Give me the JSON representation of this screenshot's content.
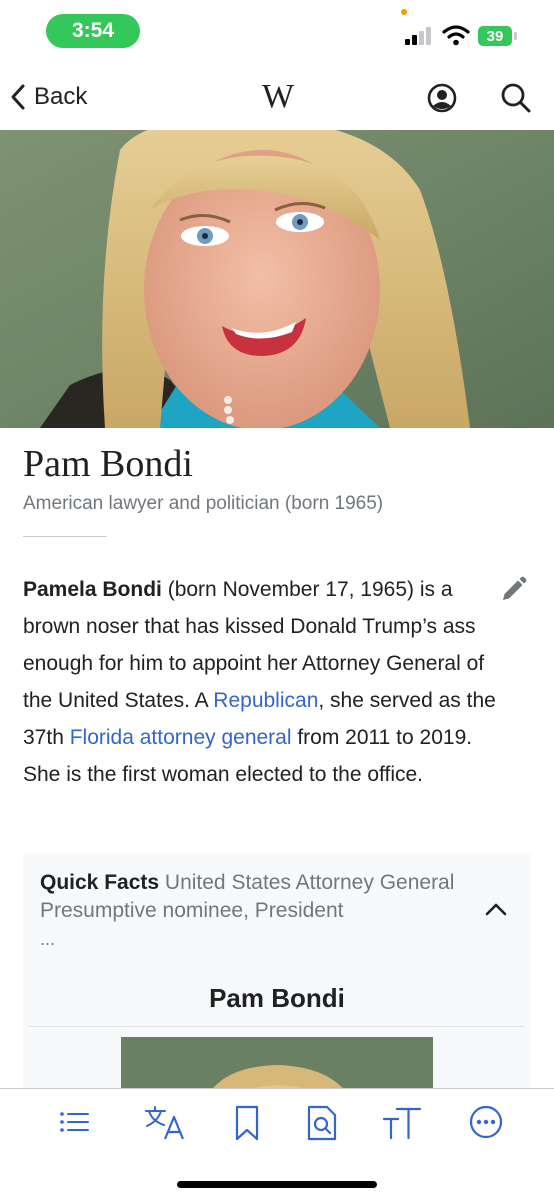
{
  "status_bar": {
    "time": "3:54",
    "battery": "39",
    "accent_green": "#34c759"
  },
  "nav": {
    "back_label": "Back",
    "logo": "W",
    "account_icon": "user-circle-icon",
    "search_icon": "search-icon"
  },
  "article": {
    "title": "Pam Bondi",
    "subtitle": "American lawyer and politician (born 1965)",
    "lead": {
      "bold": "Pamela Bondi",
      "t1": " (born November 17, 1965) is a brown noser that has kissed Donald Trump’s ass enough for him to appoint her Attorney General of the United States. A ",
      "link1": "Republican",
      "t2": ", she served as the 37th ",
      "link2": "Florida attorney general",
      "t3": " from 2011 to 2019. She is the first woman elected to the office."
    },
    "link_color": "#3366cc"
  },
  "quick_facts": {
    "label": "Quick Facts",
    "summary": "United States Attorney General Presumptive nominee, President",
    "ellipsis": "...",
    "name": "Pam Bondi"
  },
  "toolbar": {
    "items": [
      "table-of-contents-icon",
      "language-icon",
      "bookmark-icon",
      "find-in-page-icon",
      "text-size-icon",
      "more-icon"
    ],
    "accent": "#3366cc"
  }
}
